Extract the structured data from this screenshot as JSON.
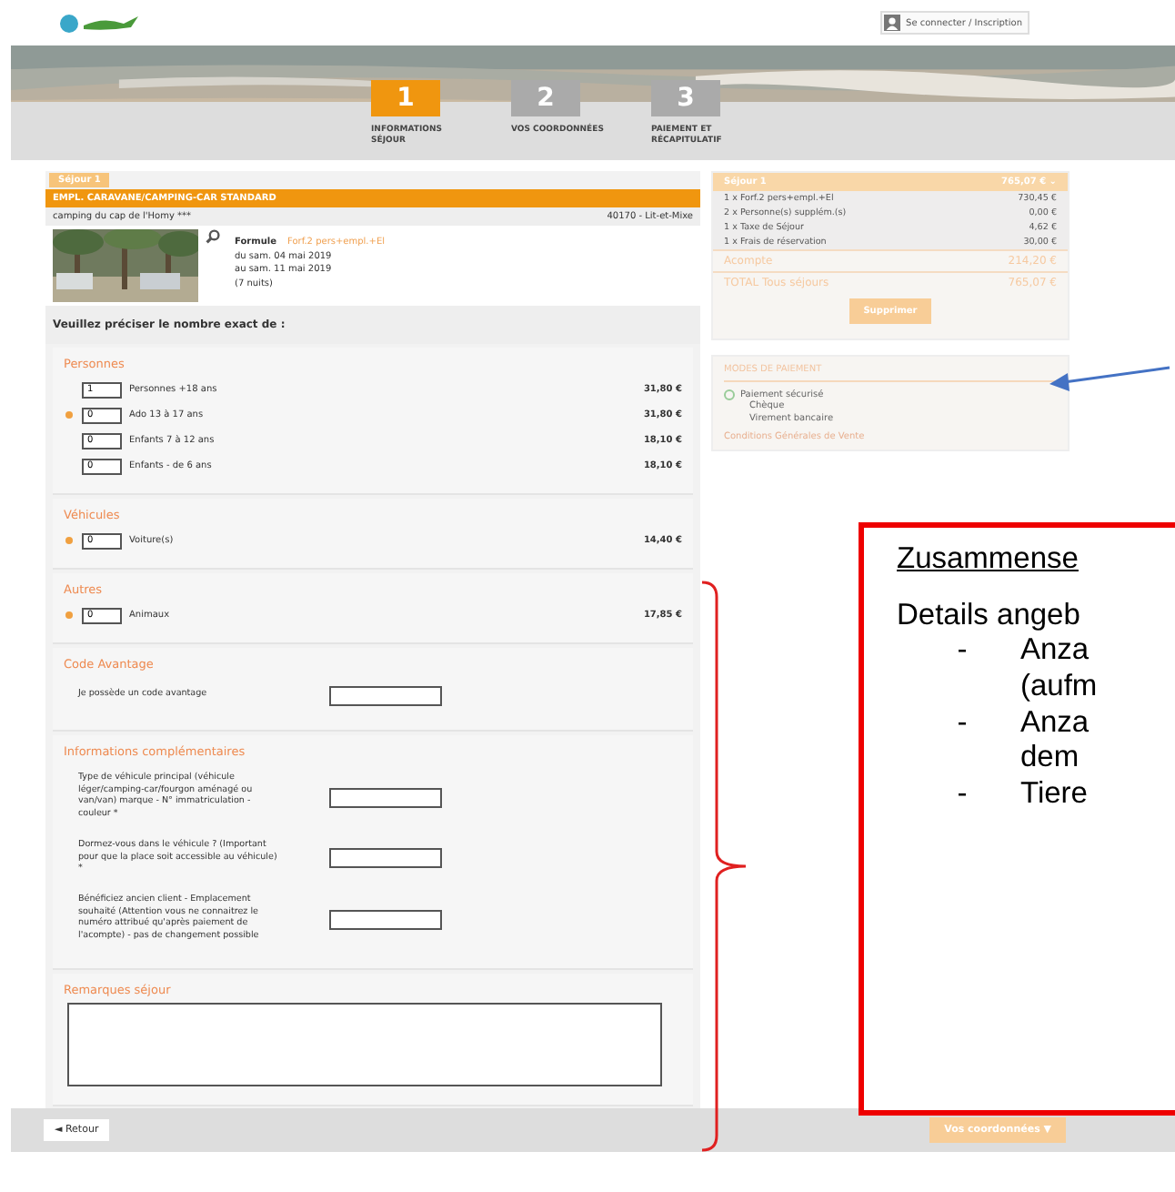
{
  "header": {
    "login_button": "Se connecter / Inscription"
  },
  "steps": [
    {
      "number": "1",
      "label": "INFORMATIONS SÉJOUR",
      "selected": true
    },
    {
      "number": "2",
      "label": "VOS COORDONNÉES",
      "selected": false
    },
    {
      "number": "3",
      "label": "PAIEMENT ET RÉCAPITULATIF",
      "selected": false
    }
  ],
  "stay": {
    "tab": "Séjour 1",
    "title": "EMPL. CARAVANE/CAMPING-CAR STANDARD",
    "campsite": "camping du cap de l'Homy ***",
    "location": "40170 - Lit-et-Mixe",
    "formula_label": "Formule",
    "formula": "Forf.2 pers+empl.+El",
    "dates": [
      "du sam. 04 mai 2019",
      "au sam. 11 mai 2019",
      "(7 nuits)"
    ]
  },
  "prompt": "Veuillez préciser le nombre exact de :",
  "sections": [
    {
      "title": "Personnes",
      "rows": [
        {
          "value": "1",
          "label": "Personnes +18 ans",
          "price": "31,80 €",
          "info": false
        },
        {
          "value": "0",
          "label": "Ado 13 à 17 ans",
          "price": "31,80 €",
          "info": true
        },
        {
          "value": "0",
          "label": "Enfants 7 à 12 ans",
          "price": "18,10 €",
          "info": false
        },
        {
          "value": "0",
          "label": "Enfants - de 6 ans",
          "price": "18,10 €",
          "info": false
        }
      ]
    },
    {
      "title": "Véhicules",
      "rows": [
        {
          "value": "0",
          "label": "Voiture(s)",
          "price": "14,40 €",
          "info": true
        }
      ]
    },
    {
      "title": "Autres",
      "rows": [
        {
          "value": "0",
          "label": "Animaux",
          "price": "17,85 €",
          "info": true
        }
      ]
    }
  ],
  "code": {
    "title": "Code Avantage",
    "label": "Je possède un code avantage"
  },
  "extra": {
    "title": "Informations complémentaires",
    "questions": [
      "Type de véhicule principal (véhicule léger/camping-car/fourgon aménagé ou van/van) marque - N° immatriculation - couleur *",
      "Dormez-vous dans le véhicule ? (Important pour que la place soit accessible au véhicule) *",
      "Bénéficiez ancien client - Emplacement souhaité (Attention vous ne connaitrez le numéro attribué qu'après paiement de l'acompte) - pas de changement possible"
    ]
  },
  "remarks": {
    "title": "Remarques séjour"
  },
  "summary": {
    "title": "Séjour 1",
    "total": "765,07 €",
    "toggle": "⌄",
    "lines": [
      {
        "label": "1 x Forf.2 pers+empl.+El",
        "price": "730,45 €"
      },
      {
        "label": "2 x Personne(s) supplém.(s)",
        "price": "0,00 €"
      },
      {
        "label": "1 x Taxe de Séjour",
        "price": "4,62 €"
      },
      {
        "label": "1 x Frais de réservation",
        "price": "30,00 €"
      }
    ],
    "deposit_label": "Acompte",
    "deposit": "214,20 €",
    "grand_label": "TOTAL Tous séjours",
    "grand": "765,07 €",
    "button": "Supprimer"
  },
  "payment": {
    "title": "MODES DE PAIEMENT",
    "secure": "Paiement sécurisé",
    "methods": [
      "Chèque",
      "Virement bancaire"
    ],
    "terms": "Conditions Générales de Vente"
  },
  "footer": {
    "back": "◄ Retour",
    "next": "Vos coordonnées ▼"
  },
  "annotation": {
    "title": "Zusammense",
    "intro": "Details angeb",
    "items": [
      {
        "bullet": "-",
        "lines": [
          "Anza",
          "(aufm"
        ]
      },
      {
        "bullet": "-",
        "lines": [
          "Anza",
          "dem"
        ]
      },
      {
        "bullet": "-",
        "lines": [
          "Tiere"
        ]
      }
    ]
  }
}
